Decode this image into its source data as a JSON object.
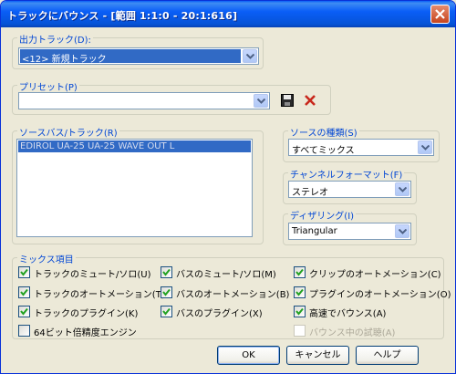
{
  "window": {
    "title": "トラックにバウンス - [範囲 1:1:0 - 20:1:616]"
  },
  "output_track": {
    "label": "出力トラック(D):",
    "value": "<12> 新規トラック"
  },
  "preset": {
    "label": "プリセット(P)",
    "value": ""
  },
  "source_bus": {
    "label": "ソースバス/トラック(R)",
    "items": [
      "EDIROL UA-25 UA-25 WAVE OUT L"
    ]
  },
  "source_type": {
    "label": "ソースの種類(S)",
    "value": "すべてミックス"
  },
  "channel_format": {
    "label": "チャンネルフォーマット(F)",
    "value": "ステレオ"
  },
  "dithering": {
    "label": "ディザリング(I)",
    "value": "Triangular"
  },
  "mix_items": {
    "label": "ミックス項目",
    "options": [
      {
        "label": "トラックのミュート/ソロ(U)",
        "checked": true
      },
      {
        "label": "バスのミュート/ソロ(M)",
        "checked": true
      },
      {
        "label": "クリップのオートメーション(C)",
        "checked": true
      },
      {
        "label": "トラックのオートメーション(T)",
        "checked": true
      },
      {
        "label": "バスのオートメーション(B)",
        "checked": true
      },
      {
        "label": "プラグインのオートメーション(O)",
        "checked": true
      },
      {
        "label": "トラックのプラグイン(K)",
        "checked": true
      },
      {
        "label": "バスのプラグイン(X)",
        "checked": true
      },
      {
        "label": "高速でバウンス(A)",
        "checked": true
      },
      {
        "label": "64ビット倍精度エンジン",
        "checked": false
      },
      {
        "label": "バウンス中の試聴(A)",
        "checked": false,
        "disabled": true
      }
    ]
  },
  "buttons": {
    "ok": "OK",
    "cancel": "キャンセル",
    "help": "ヘルプ"
  },
  "colors": {
    "title_bar": "#0a5ef7",
    "group_label": "#0046d5",
    "selection": "#316ac5",
    "dialog_bg": "#ece9d8"
  },
  "icons": {
    "save": "floppy-disk-icon",
    "delete": "red-x-icon",
    "close": "close-icon"
  }
}
